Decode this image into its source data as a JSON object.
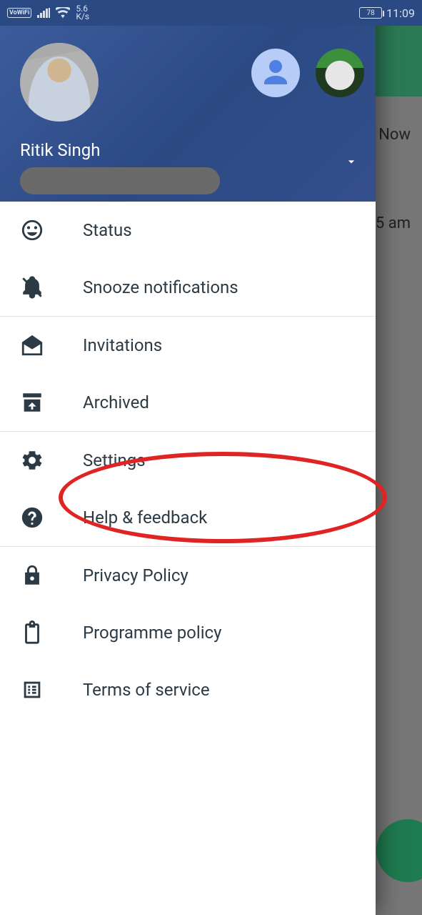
{
  "statusbar": {
    "vowifi": "VoWiFi",
    "speed_top": "5.6",
    "speed_bottom": "K/s",
    "battery": "78",
    "time": "11:09"
  },
  "background": {
    "line1": "Now",
    "line2": "5 am"
  },
  "header": {
    "user_name": "Ritik Singh"
  },
  "menu": {
    "status": "Status",
    "snooze": "Snooze notifications",
    "invitations": "Invitations",
    "archived": "Archived",
    "settings": "Settings",
    "help": "Help & feedback",
    "privacy": "Privacy Policy",
    "programme": "Programme policy",
    "terms": "Terms of service"
  }
}
